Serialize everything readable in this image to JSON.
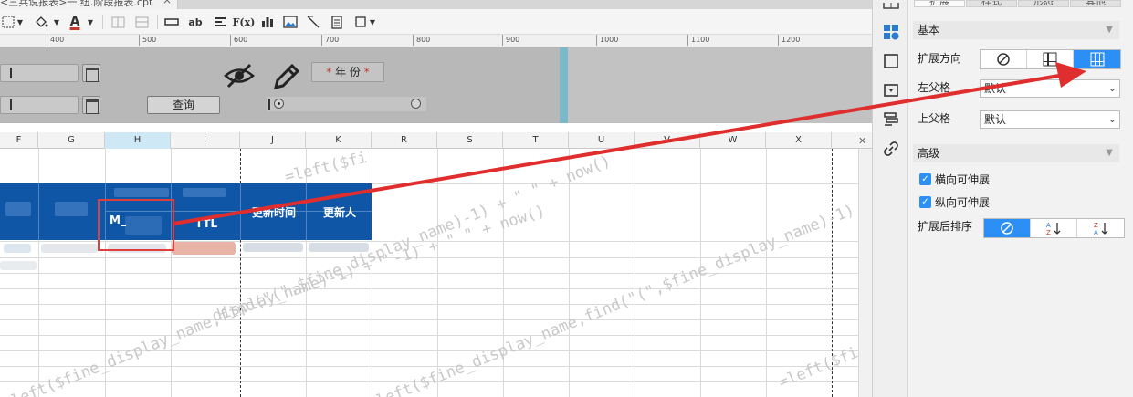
{
  "tab": {
    "title": "<三兵说报表>一.纽.阶段报表.cpt",
    "close": "×"
  },
  "toolbar": {
    "font_color_letter": "A",
    "text_btn": "ab",
    "formula_btn": "F(x)"
  },
  "ruler": {
    "marks": [
      "400",
      "500",
      "600",
      "700",
      "800",
      "900",
      "1000",
      "1100",
      "1200"
    ]
  },
  "params": {
    "query_label": "查询",
    "year_label": "年 份",
    "year_star": "*"
  },
  "columns": {
    "headers": [
      "F",
      "G",
      "H",
      "I",
      "J",
      "K",
      "R",
      "S",
      "T",
      "U",
      "V",
      "W",
      "X"
    ],
    "selected": "H"
  },
  "sheet": {
    "header_update_time": "更新时间",
    "header_updater": "更新人",
    "header_ttl": "TTL",
    "header_m": "M_",
    "watermark": "=left($fine_display_name,find(\"(\",$fine_display_name)-1) + \" \" + now()",
    "watermark_short": "=left($fi",
    "watermark_now": "-1) + \" \" + now()",
    "watermark_name": "display_name)-1) + \"",
    "watermark_tail": "=left($fine_display_name)-1) + \""
  },
  "panel": {
    "tabs": [
      "扩展",
      "样式",
      "形态",
      "其他"
    ],
    "active_tab": "扩展",
    "section_basic": "基本",
    "expand_direction_label": "扩展方向",
    "left_parent_label": "左父格",
    "left_parent_value": "默认",
    "top_parent_label": "上父格",
    "top_parent_value": "默认",
    "section_advanced": "高级",
    "h_expand_label": "横向可伸展",
    "v_expand_label": "纵向可伸展",
    "sort_label": "扩展后排序",
    "accent": "#2b8ff5"
  }
}
